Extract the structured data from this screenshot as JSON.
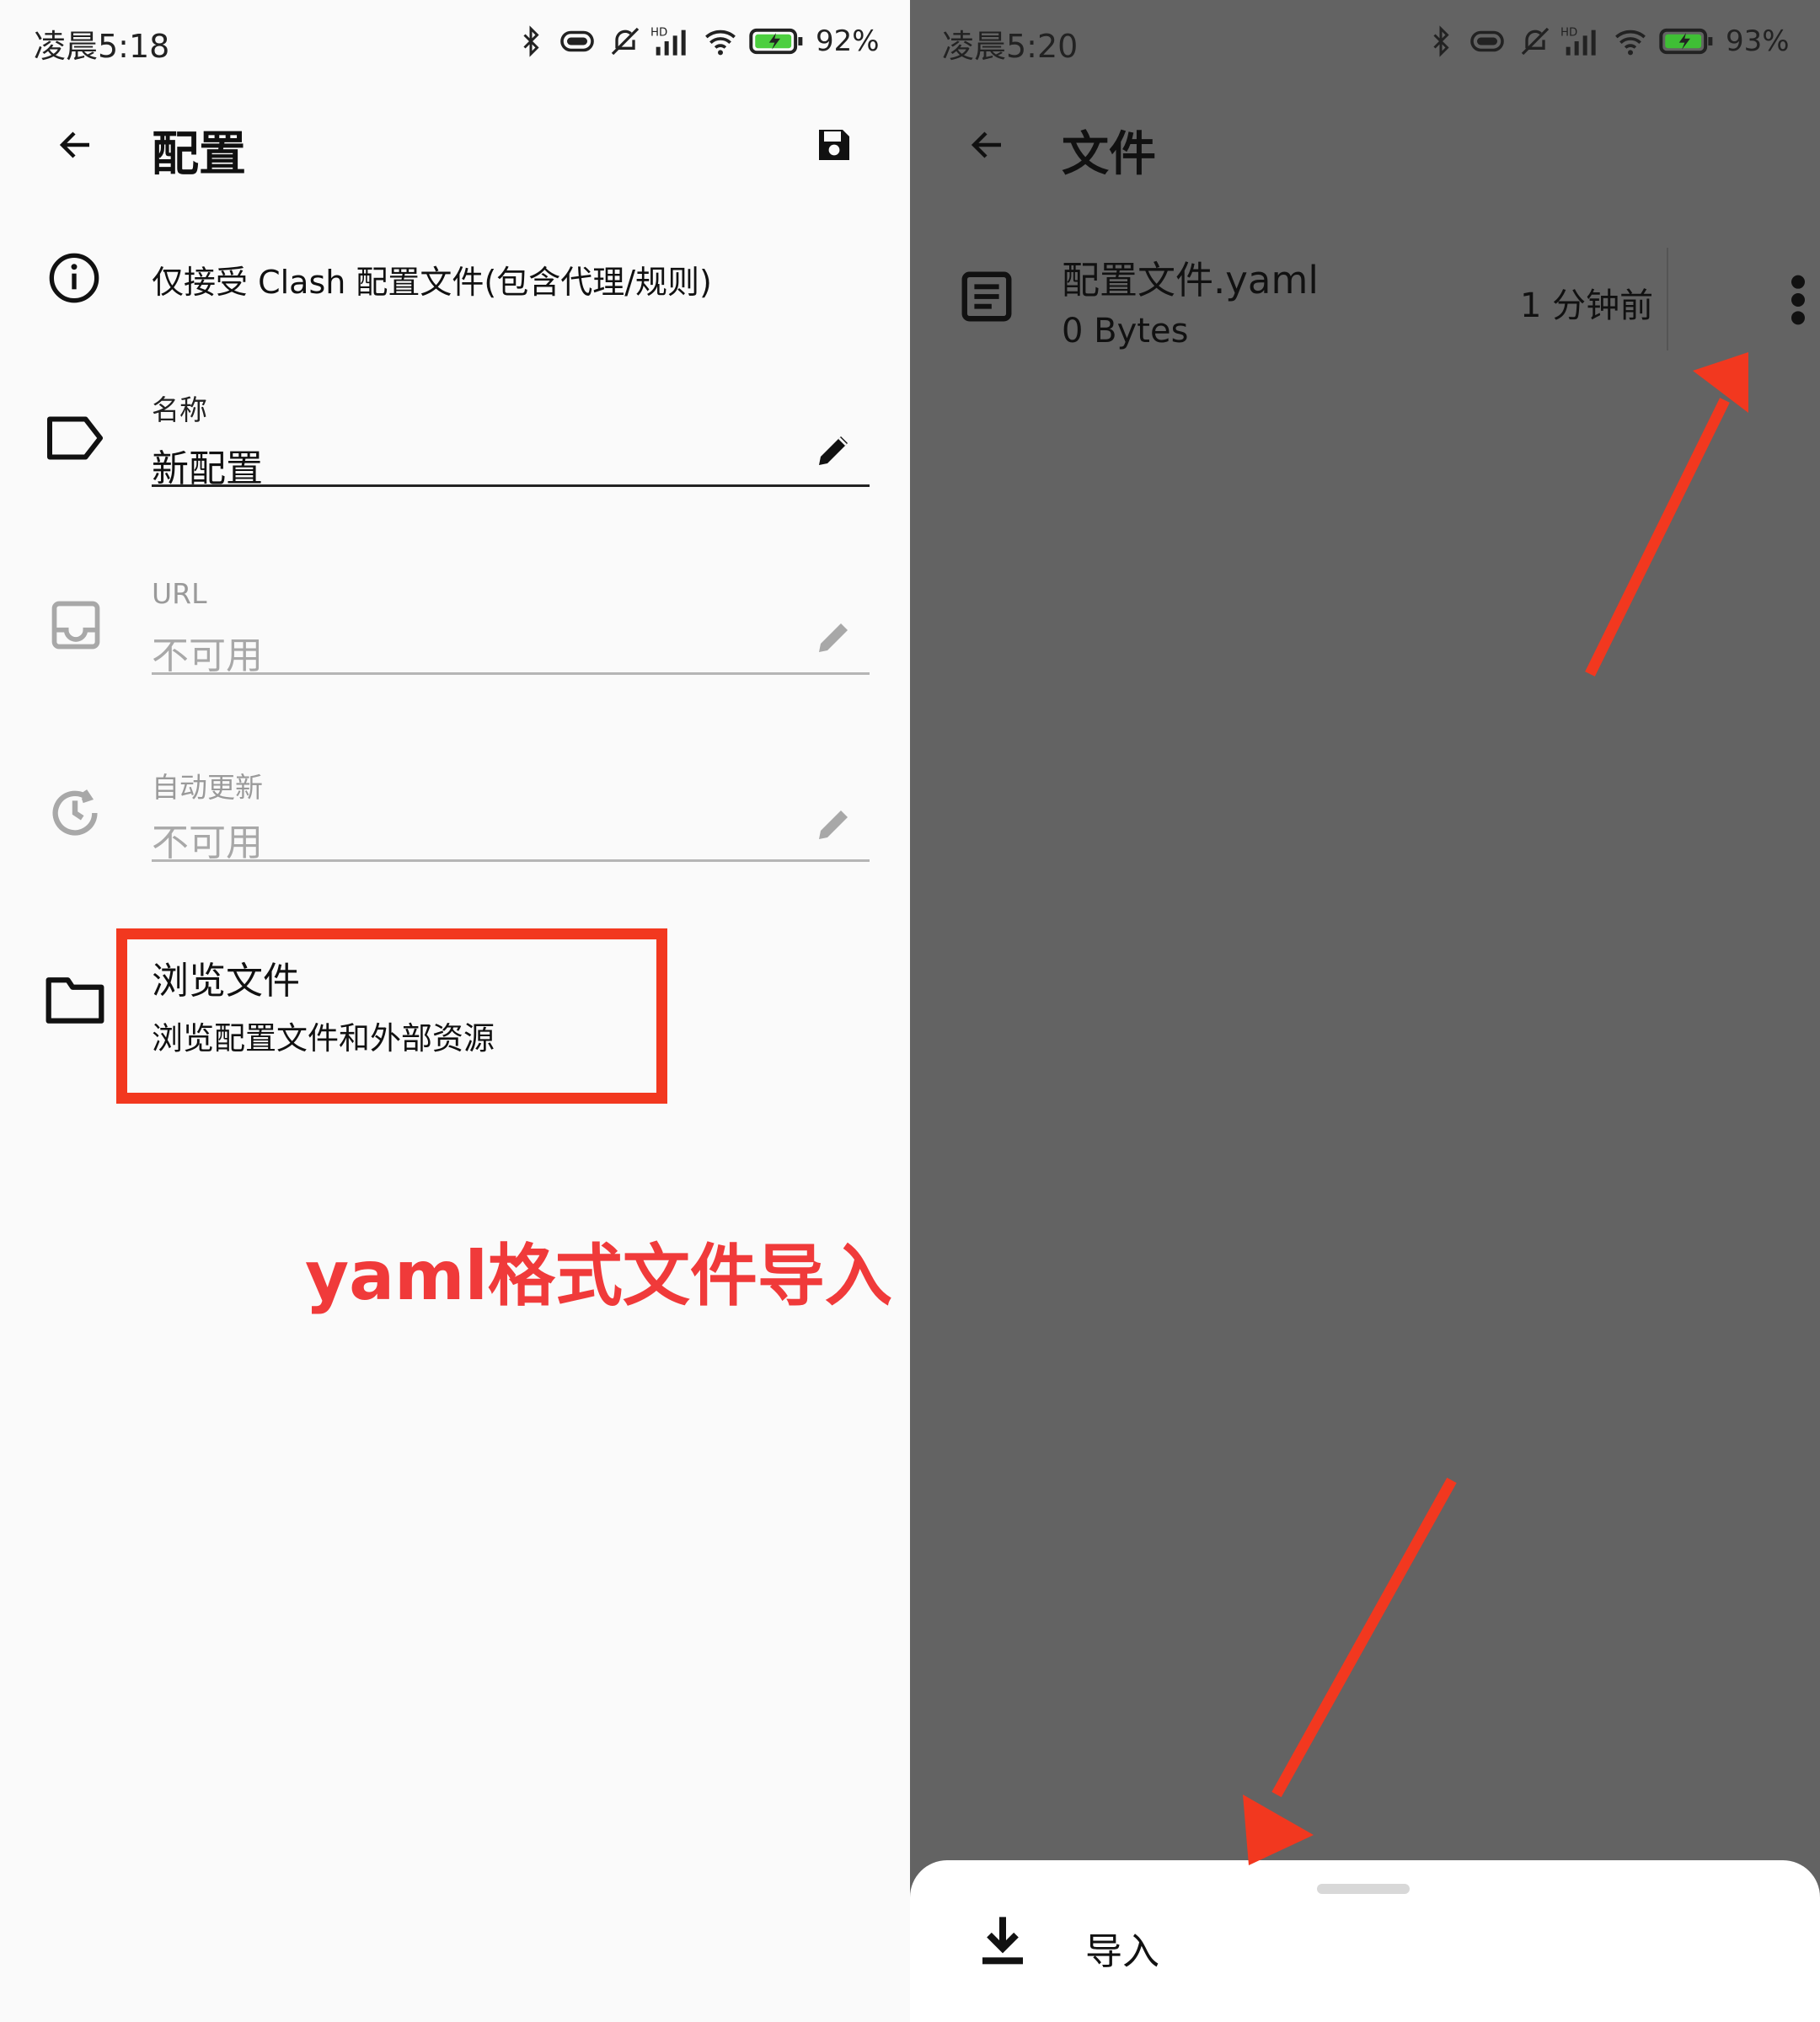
{
  "left": {
    "status": {
      "time": "凌晨5:18",
      "battery": "92%"
    },
    "appbar": {
      "title": "配置"
    },
    "info": {
      "text": "仅接受 Clash 配置文件(包含代理/规则)"
    },
    "fields": [
      {
        "label": "名称",
        "value": "新配置",
        "enabled": true
      },
      {
        "label": "URL",
        "value": "不可用",
        "enabled": false
      },
      {
        "label": "自动更新",
        "value": "不可用",
        "enabled": false
      }
    ],
    "browse": {
      "title": "浏览文件",
      "subtitle": "浏览配置文件和外部资源"
    },
    "annotation": "yaml格式文件导入"
  },
  "right": {
    "status": {
      "time": "凌晨5:20",
      "battery": "93%"
    },
    "appbar": {
      "title": "文件"
    },
    "file": {
      "name": "配置文件.yaml",
      "size": "0 Bytes",
      "modified": "1 分钟前"
    },
    "sheet": {
      "action_label": "导入"
    }
  },
  "icons": {
    "status": [
      "bluetooth-icon",
      "vibrate-icon",
      "mute-bell-icon",
      "signal-icon",
      "wifi-icon",
      "battery-icon"
    ]
  },
  "colors": {
    "annotation": "#f2381f",
    "annotation_text": "#f03a3a",
    "scrim": "#636363"
  }
}
